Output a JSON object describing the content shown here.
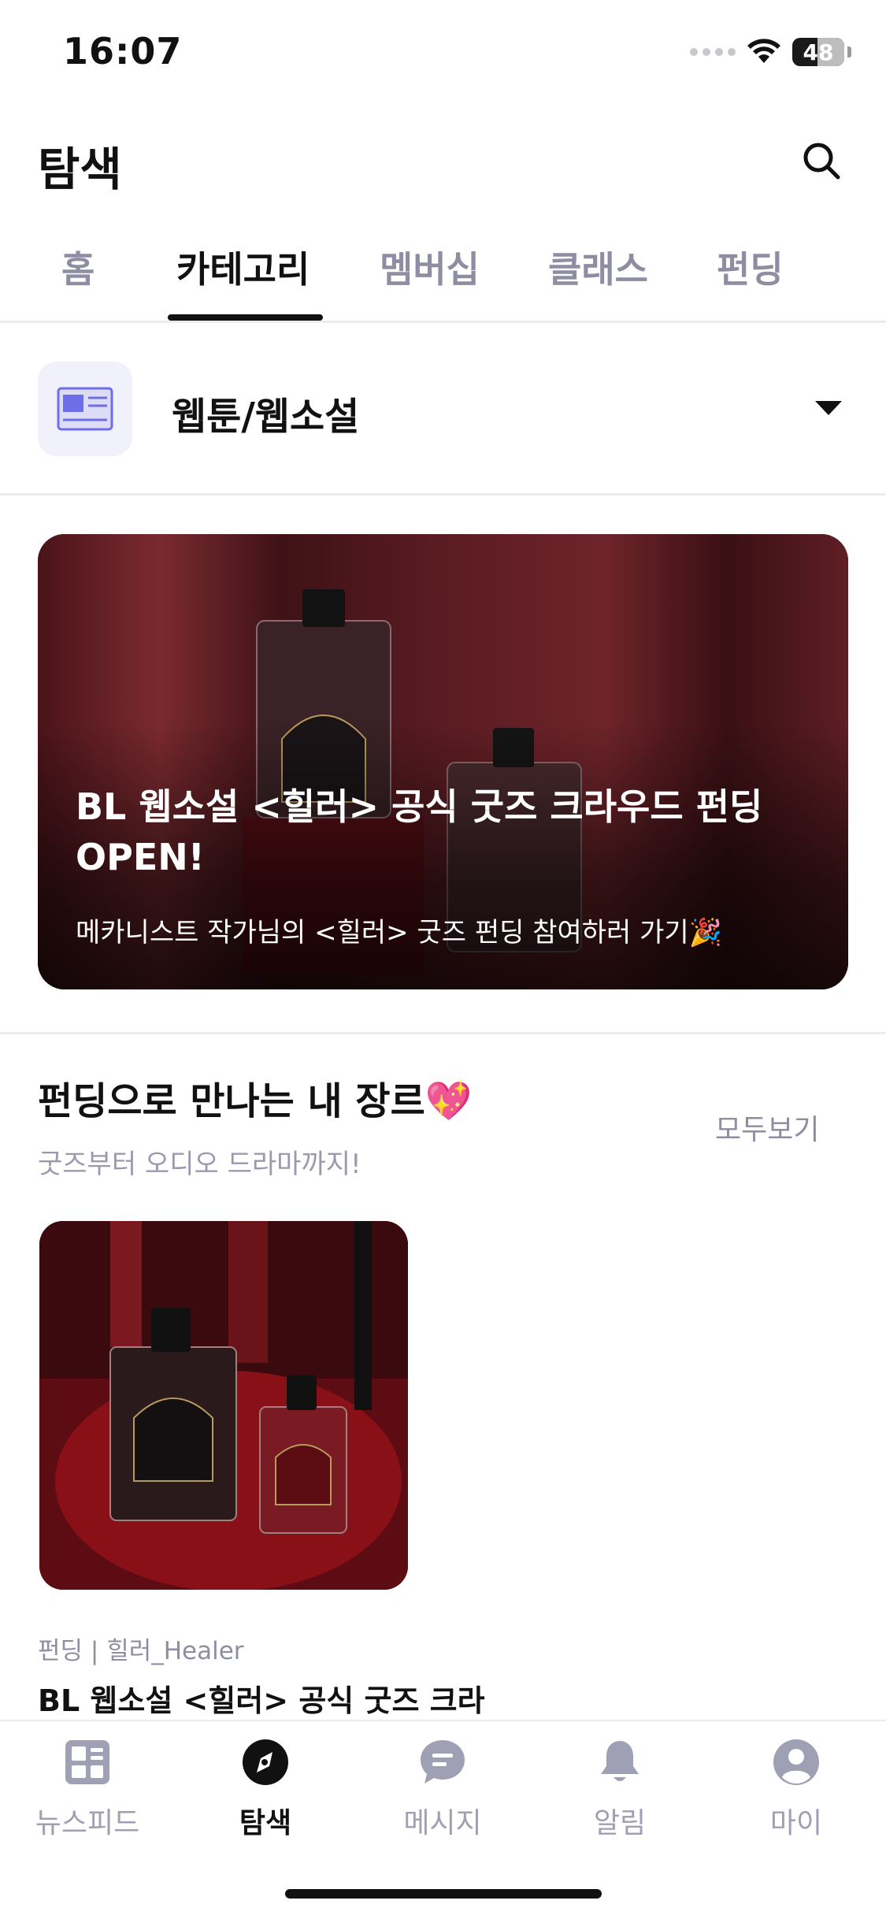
{
  "status_bar": {
    "time": "16:07",
    "battery_level": "48",
    "battery_percent": 48
  },
  "header": {
    "title": "탐색",
    "search_icon": "search-icon"
  },
  "tabs": [
    {
      "label": "홈",
      "active": false
    },
    {
      "label": "카테고리",
      "active": true
    },
    {
      "label": "멤버십",
      "active": false
    },
    {
      "label": "클래스",
      "active": false
    },
    {
      "label": "펀딩",
      "active": false
    }
  ],
  "category": {
    "label": "웹툰/웹소설",
    "icon": "webtoon-book-icon",
    "icon_color": "#6e6ee8"
  },
  "banner": {
    "title": "BL 웹소설 <힐러> 공식 굿즈 크라우드 펀딩 OPEN!",
    "subtitle": "메카니스트 작가님의 <힐러> 굿즈 펀딩 참여하러 가기🎉"
  },
  "section": {
    "title": "펀딩으로 만나는 내 장르💖",
    "subtitle": "굿즈부터 오디오 드라마까지!",
    "see_all": "모두보기"
  },
  "card": {
    "meta": "펀딩 | 힐러_Healer",
    "title": "BL 웹소설 <힐러> 공식 굿즈 크라"
  },
  "bottom_nav": [
    {
      "label": "뉴스피드",
      "icon": "newsfeed-icon",
      "active": false
    },
    {
      "label": "탐색",
      "icon": "compass-icon",
      "active": true
    },
    {
      "label": "메시지",
      "icon": "message-icon",
      "active": false
    },
    {
      "label": "알림",
      "icon": "bell-icon",
      "active": false
    },
    {
      "label": "마이",
      "icon": "profile-icon",
      "active": false
    }
  ],
  "colors": {
    "accent": "#111111",
    "inactive": "#8e8ea3",
    "nav_inactive_icon": "#a0a0b4",
    "divider": "#ececf0"
  }
}
